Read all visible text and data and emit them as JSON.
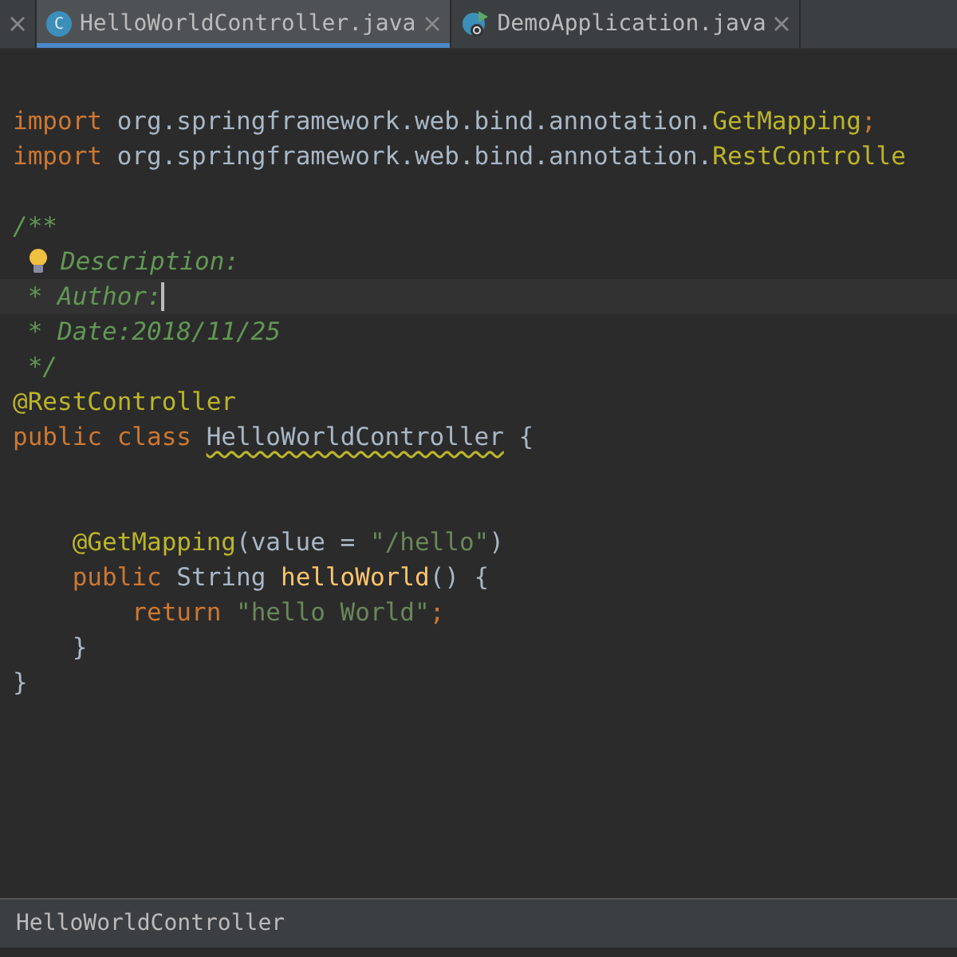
{
  "tabs": [
    {
      "kind": "cut",
      "selected": false
    },
    {
      "kind": "class",
      "icon_letter": "C",
      "label": "HelloWorldController.java",
      "selected": true
    },
    {
      "kind": "app",
      "label": "DemoApplication.java",
      "selected": false
    }
  ],
  "editor": {
    "lines": [
      {
        "tokens": [
          {
            "kind": "keyword",
            "text": "import"
          },
          {
            "kind": "plain",
            "text": " org.springframework.web.bind.annotation."
          },
          {
            "kind": "annotation",
            "text": "GetMapping"
          },
          {
            "kind": "keyword",
            "text": ";"
          }
        ]
      },
      {
        "tokens": [
          {
            "kind": "keyword",
            "text": "import"
          },
          {
            "kind": "plain",
            "text": " org.springframework.web.bind.annotation."
          },
          {
            "kind": "annotation",
            "text": "RestControlle"
          }
        ]
      },
      {
        "blank": true
      },
      {
        "tokens": [
          {
            "kind": "comment",
            "text": "/**"
          }
        ]
      },
      {
        "bulb": true,
        "tokens": [
          {
            "kind": "comment",
            "text": "Description:"
          }
        ]
      },
      {
        "current": true,
        "tokens": [
          {
            "kind": "comment",
            "text": " * Author:"
          }
        ]
      },
      {
        "tokens": [
          {
            "kind": "comment",
            "text": " * Date:2018/11/25"
          }
        ]
      },
      {
        "tokens": [
          {
            "kind": "comment",
            "text": " */"
          }
        ]
      },
      {
        "tokens": [
          {
            "kind": "annotation",
            "text": "@RestController"
          }
        ]
      },
      {
        "tokens": [
          {
            "kind": "keyword",
            "text": "public class "
          },
          {
            "kind": "warning",
            "text": "HelloWorldController"
          },
          {
            "kind": "plain",
            "text": " {"
          }
        ]
      },
      {
        "blank": true
      },
      {
        "blank": true
      },
      {
        "tokens": [
          {
            "kind": "annotation",
            "text": "    @GetMapping"
          },
          {
            "kind": "plain",
            "text": "(value = "
          },
          {
            "kind": "string",
            "text": "\"/hello\""
          },
          {
            "kind": "plain",
            "text": ")"
          }
        ]
      },
      {
        "tokens": [
          {
            "kind": "keyword",
            "text": "    public "
          },
          {
            "kind": "plain",
            "text": "String "
          },
          {
            "kind": "method",
            "text": "helloWorld"
          },
          {
            "kind": "plain",
            "text": "() {"
          }
        ]
      },
      {
        "tokens": [
          {
            "kind": "keyword",
            "text": "        return "
          },
          {
            "kind": "string",
            "text": "\"hello World\""
          },
          {
            "kind": "keyword",
            "text": ";"
          }
        ]
      },
      {
        "tokens": [
          {
            "kind": "plain",
            "text": "    }"
          }
        ]
      },
      {
        "tokens": [
          {
            "kind": "plain",
            "text": "}"
          }
        ]
      }
    ]
  },
  "status_bar": {
    "text": "HelloWorldController"
  }
}
